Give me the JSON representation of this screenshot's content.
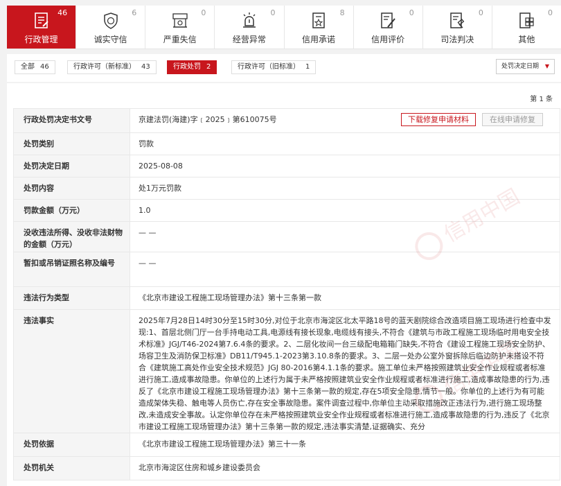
{
  "tabs": [
    {
      "label": "行政管理",
      "count": "46",
      "icon": "document-edit-icon",
      "active": true
    },
    {
      "label": "诚实守信",
      "count": "6",
      "icon": "shield-icon",
      "active": false
    },
    {
      "label": "严重失信",
      "count": "0",
      "icon": "blacklist-icon",
      "active": false
    },
    {
      "label": "经营异常",
      "count": "0",
      "icon": "alarm-icon",
      "active": false
    },
    {
      "label": "信用承诺",
      "count": "8",
      "icon": "star-document-icon",
      "active": false
    },
    {
      "label": "信用评价",
      "count": "0",
      "icon": "pen-document-icon",
      "active": false
    },
    {
      "label": "司法判决",
      "count": "0",
      "icon": "gavel-document-icon",
      "active": false
    },
    {
      "label": "其他",
      "count": "0",
      "icon": "grid-document-icon",
      "active": false
    }
  ],
  "filters": [
    {
      "label": "全部",
      "count": "46",
      "active": false
    },
    {
      "label": "行政许可（新标准）",
      "count": "43",
      "active": false
    },
    {
      "label": "行政处罚",
      "count": "2",
      "active": true
    },
    {
      "label": "行政许可（旧标准）",
      "count": "1",
      "active": false
    }
  ],
  "sort": {
    "label": "处罚决定日期"
  },
  "page_info": "第 1 条",
  "actions": {
    "download": "下载修复申请材料",
    "online": "在线申请修复"
  },
  "watermark": "信用中国",
  "rows": [
    {
      "key": "行政处罚决定书文号",
      "value": "京建法罚(海建)字﹝2025﹞第610075号"
    },
    {
      "key": "处罚类别",
      "value": "罚款"
    },
    {
      "key": "处罚决定日期",
      "value": "2025-08-08"
    },
    {
      "key": "处罚内容",
      "value": "处1万元罚款"
    },
    {
      "key": "罚款金额（万元）",
      "value": "1.0"
    },
    {
      "key": "没收违法所得、没收非法财物的金额（万元）",
      "value": "— —"
    },
    {
      "key": "暂扣或吊销证照名称及编号",
      "value": "— —"
    },
    {
      "key": "违法行为类型",
      "value": "《北京市建设工程施工现场管理办法》第十三条第一款"
    },
    {
      "key": "违法事实",
      "value": "2025年7月28日14时30分至15时30分,对位于北京市海淀区北太平路18号的蓝天剧院综合改造项目施工现场进行检查中发现:1、首层北侧门厅一台手持电动工具,电源线有接长现象,电缆线有接头,不符合《建筑与市政工程施工现场临时用电安全技术标准》JGJ/T46-2024第7.6.4条的要求。2、二层化妆间一台三级配电箱箱门缺失,不符合《建设工程施工现场安全防护、场容卫生及消防保卫标准》DB11/T945.1-2023第3.10.8条的要求。3、二层一处办公室外窗拆除后临边防护未搭设不符合《建筑施工高处作业安全技术规范》JGJ 80-2016第4.1.1条的要求。施工单位未严格按照建筑业安全作业规程或者标准进行施工,造成事故隐患。你单位的上述行为属于未严格按照建筑业安全作业规程或者标准进行施工,造成事故隐患的行为,违反了《北京市建设工程施工现场管理办法》第十三条第一款的规定,存在5项安全隐患,情节一般。你单位的上述行为有可能造成架体失稳、触电等人员伤亡,存在安全事故隐患。案件调查过程中,你单位主动采取措施改正违法行为,进行施工现场整改,未造成安全事故。认定你单位存在未严格按照建筑业安全作业规程或者标准进行施工,造成事故隐患的行为,违反了《北京市建设工程施工现场管理办法》第十三条第一款的规定,违法事实清楚,证据确实、充分"
    },
    {
      "key": "处罚依据",
      "value": "《北京市建设工程施工现场管理办法》第三十一条"
    },
    {
      "key": "处罚机关",
      "value": "北京市海淀区住房和城乡建设委员会"
    }
  ]
}
